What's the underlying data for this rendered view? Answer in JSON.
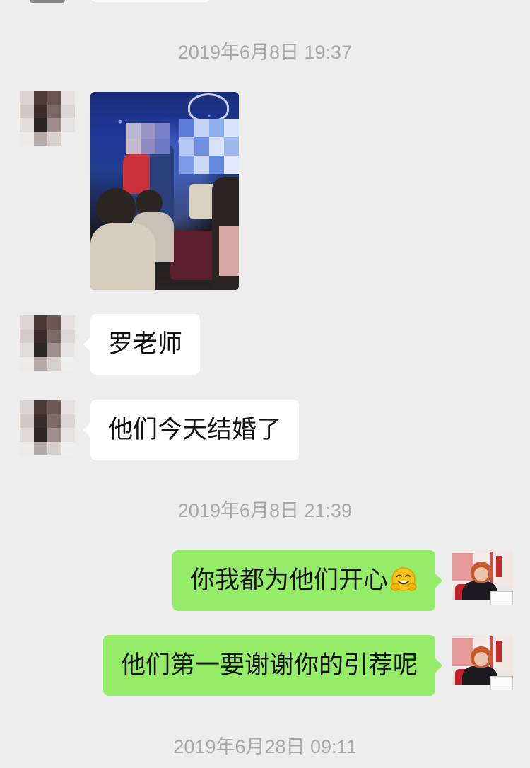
{
  "timestamps": {
    "t1": "2019年6月8日 19:37",
    "t2": "2019年6月8日 21:39",
    "t3": "2019年6月28日 09:11"
  },
  "messages": {
    "incoming_1": "罗老师",
    "incoming_2": "他们今天结婚了",
    "outgoing_1": "你我都为他们开心",
    "outgoing_2": "他们第一要谢谢你的引荐呢"
  },
  "icons": {
    "emoji": "hugging-face-emoji",
    "image": "wedding-photo"
  },
  "colors": {
    "background": "#ededed",
    "incoming_bubble": "#ffffff",
    "outgoing_bubble": "#95ec69",
    "timestamp_text": "#a7a7a7"
  }
}
